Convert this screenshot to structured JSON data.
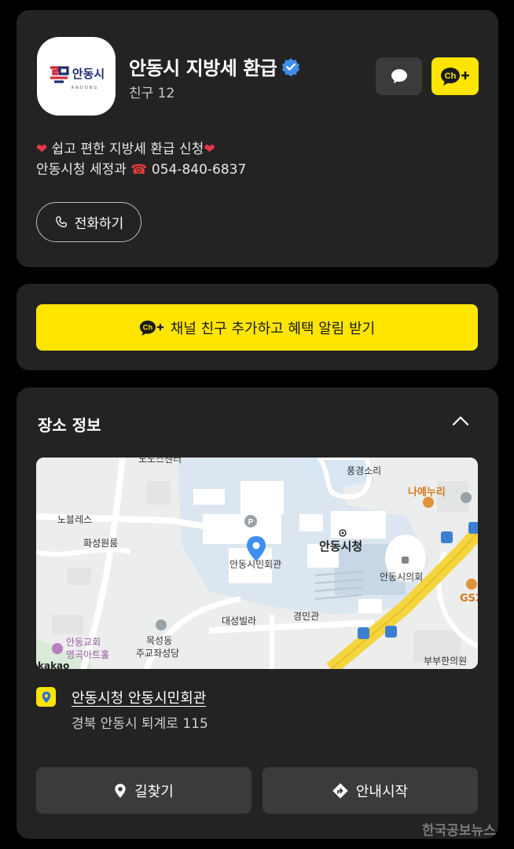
{
  "profile": {
    "logo_text": "안동시",
    "logo_sub": "ANDONG",
    "title": "안동시 지방세 환급",
    "friends": "친구 12",
    "desc_line1": "쉽고 편한 지방세 환급 신청",
    "desc_heart": "❤",
    "desc_line2_prefix": "안동시청 세정과",
    "desc_phone_emoji": "☎",
    "desc_phone": "054-840-6837",
    "call_label": "전화하기"
  },
  "add_channel": {
    "label": "채널 친구 추가하고 혜택 알림 받기"
  },
  "place": {
    "heading": "장소 정보",
    "map_labels": {
      "l1": "풍경소리",
      "l2": "나예누리",
      "l3": "노블레스",
      "l4": "화성원룸",
      "l5": "안동시청",
      "l6": "안동시민회관",
      "l7": "안동시의회",
      "l8": "대성빌라",
      "l9": "경민관",
      "l10": "목성동",
      "l11": "주교좌성당",
      "l12": "안동교회",
      "l13": "영곡아트홀",
      "l14": "부부한의원",
      "l15": "GS2",
      "l16": "kakao",
      "l17": "노도스센터"
    },
    "location_name": "안동시청 안동시민회관",
    "address": "경북 안동시 퇴계로 115",
    "route_label": "길찾기",
    "nav_label": "안내시작"
  },
  "watermark": "한국공보뉴스",
  "colors": {
    "yellow": "#fee500",
    "card": "#232323",
    "button": "#3b3b3b",
    "verified": "#3d8ee8"
  }
}
